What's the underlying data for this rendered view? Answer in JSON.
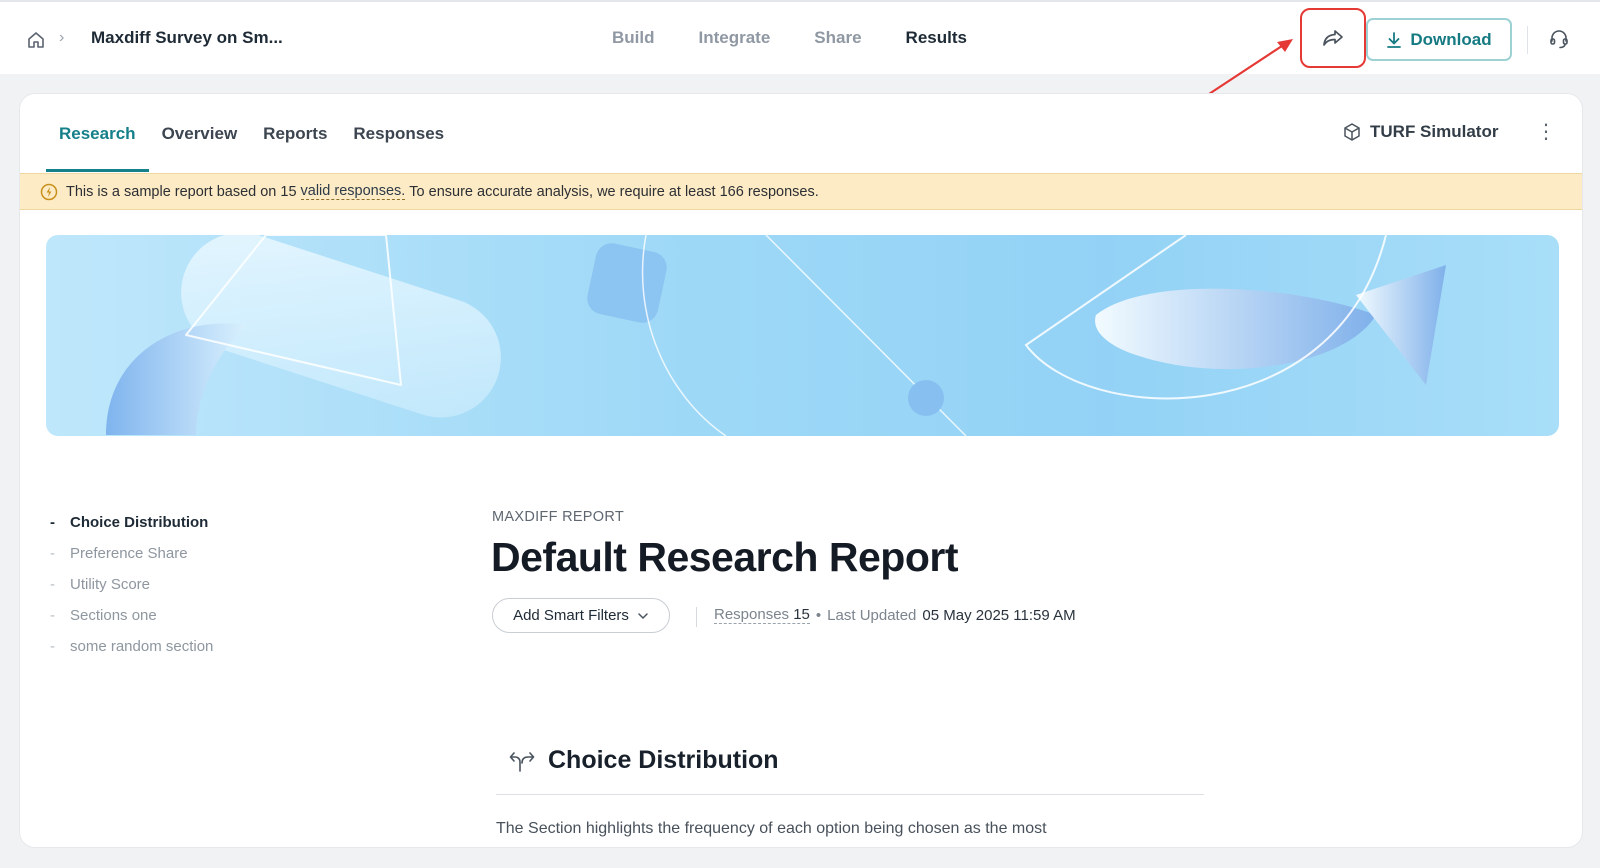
{
  "header": {
    "survey_title": "Maxdiff Survey on Sm...",
    "tabs": [
      {
        "label": "Build"
      },
      {
        "label": "Integrate"
      },
      {
        "label": "Share"
      },
      {
        "label": "Results"
      }
    ],
    "active_tab": "Results",
    "download_label": "Download"
  },
  "subnav": {
    "tabs": [
      {
        "label": "Research"
      },
      {
        "label": "Overview"
      },
      {
        "label": "Reports"
      },
      {
        "label": "Responses"
      }
    ],
    "active_tab": "Research",
    "turf_label": "TURF Simulator",
    "more_label": "⋮"
  },
  "banner": {
    "text_before": "This is a sample report based on 15",
    "link_text": "valid responses.",
    "text_after": "To ensure accurate analysis, we require at least 166 responses."
  },
  "outline": {
    "items": [
      {
        "label": "Choice Distribution",
        "active": true
      },
      {
        "label": "Preference Share",
        "active": false
      },
      {
        "label": "Utility Score",
        "active": false
      },
      {
        "label": "Sections one",
        "active": false
      },
      {
        "label": "some random section",
        "active": false
      }
    ],
    "dash": "-"
  },
  "report": {
    "kicker": "MAXDIFF REPORT",
    "title": "Default Research Report",
    "filters_label": "Add Smart Filters",
    "responses_label": "Responses",
    "responses_value": "15",
    "separator": "•",
    "updated_label": "Last Updated",
    "updated_value": "05 May 2025 11:59 AM"
  },
  "section": {
    "title": "Choice Distribution",
    "description": "The Section highlights the frequency of each option being chosen as the most"
  },
  "colors": {
    "accent": "#16808a",
    "annotation_red": "#e53935",
    "banner_bg": "#fdebc6"
  }
}
